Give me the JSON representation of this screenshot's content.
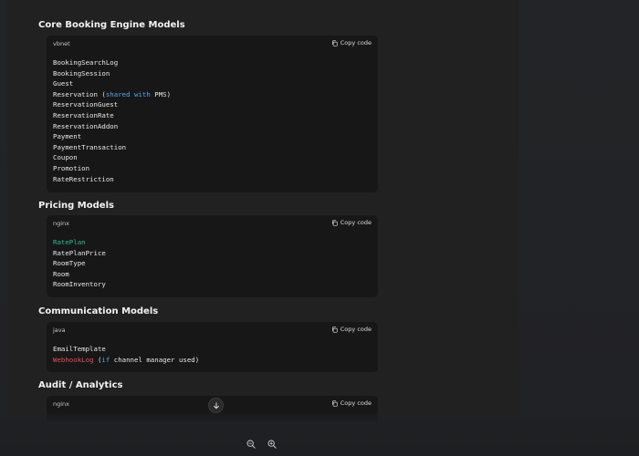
{
  "sections": [
    {
      "title": "Core Booking Engine Models",
      "lang": "vbnet",
      "copy_label": "Copy code",
      "lines": [
        [
          {
            "t": "BookingSearchLog"
          }
        ],
        [
          {
            "t": "BookingSession"
          }
        ],
        [
          {
            "t": "Guest"
          }
        ],
        [
          {
            "t": "Reservation ("
          },
          {
            "t": "shared",
            "c": "kw"
          },
          {
            "t": " "
          },
          {
            "t": "with",
            "c": "kw"
          },
          {
            "t": " PMS)"
          }
        ],
        [
          {
            "t": "ReservationGuest"
          }
        ],
        [
          {
            "t": "ReservationRate"
          }
        ],
        [
          {
            "t": "ReservationAddon"
          }
        ],
        [
          {
            "t": "Payment"
          }
        ],
        [
          {
            "t": "PaymentTransaction"
          }
        ],
        [
          {
            "t": "Coupon"
          }
        ],
        [
          {
            "t": "Promotion"
          }
        ],
        [
          {
            "t": "RateRestriction"
          }
        ]
      ]
    },
    {
      "title": "Pricing Models",
      "lang": "nginx",
      "copy_label": "Copy code",
      "lines": [
        [
          {
            "t": "RatePlan",
            "c": "grn"
          }
        ],
        [
          {
            "t": "RatePlanPrice"
          }
        ],
        [
          {
            "t": "RoomType"
          }
        ],
        [
          {
            "t": "Room"
          }
        ],
        [
          {
            "t": "RoomInventory"
          }
        ]
      ]
    },
    {
      "title": "Communication Models",
      "lang": "java",
      "copy_label": "Copy code",
      "lines": [
        [
          {
            "t": "EmailTemplate"
          }
        ],
        [
          {
            "t": "WebhookLog",
            "c": "red"
          },
          {
            "t": " ("
          },
          {
            "t": "if",
            "c": "kw"
          },
          {
            "t": " channel manager used)"
          }
        ]
      ]
    },
    {
      "title": "Audit / Analytics",
      "lang": "nginx",
      "copy_label": "Copy code",
      "lines": []
    }
  ],
  "icons": {
    "copy": "copy-icon",
    "scroll_down": "arrow-down-icon",
    "zoom_out": "zoom-out-icon",
    "zoom_in": "zoom-in-icon"
  }
}
